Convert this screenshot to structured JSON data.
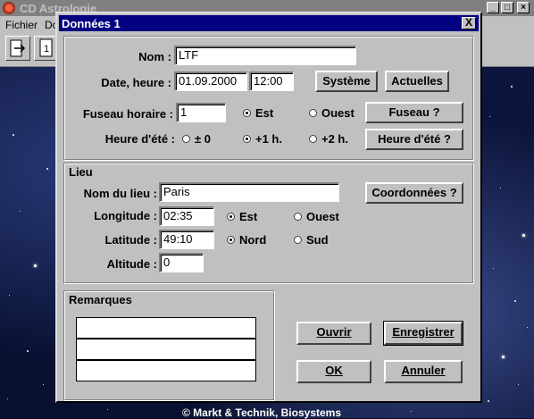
{
  "app": {
    "title": "CD Astrologie",
    "menu": [
      "Fichier",
      "Do"
    ],
    "copyright": "© Markt & Technik, Biosystems"
  },
  "dialog": {
    "title": "Données 1",
    "close_label": "X",
    "nom_label": "Nom :",
    "nom_value": "LTF",
    "date_label": "Date, heure :",
    "date_value": "01.09.2000",
    "heure_value": "12:00",
    "systeme_label": "Système",
    "actuelles_label": "Actuelles",
    "fuseau_label": "Fuseau horaire :",
    "fuseau_value": "1",
    "fuseau_est": "Est",
    "fuseau_ouest": "Ouest",
    "fuseau_selected": "Est",
    "fuseau_button": "Fuseau ?",
    "ete_label": "Heure d'été :",
    "ete_opt0": "± 0",
    "ete_opt1": "+1 h.",
    "ete_opt2": "+2 h.",
    "ete_selected": "+1 h.",
    "ete_button": "Heure d'été ?",
    "lieu_group": "Lieu",
    "lieu_label": "Nom du lieu :",
    "lieu_value": "Paris",
    "coord_button": "Coordonnées ?",
    "longitude_label": "Longitude :",
    "longitude_value": "02:35",
    "long_est": "Est",
    "long_ouest": "Ouest",
    "long_selected": "Est",
    "latitude_label": "Latitude :",
    "latitude_value": "49:10",
    "lat_nord": "Nord",
    "lat_sud": "Sud",
    "lat_selected": "Nord",
    "altitude_label": "Altitude :",
    "altitude_value": "0",
    "remarques_group": "Remarques",
    "ouvrir_label": "Ouvrir",
    "enregistrer_label": "Enregistrer",
    "ok_label": "OK",
    "annuler_label": "Annuler"
  }
}
